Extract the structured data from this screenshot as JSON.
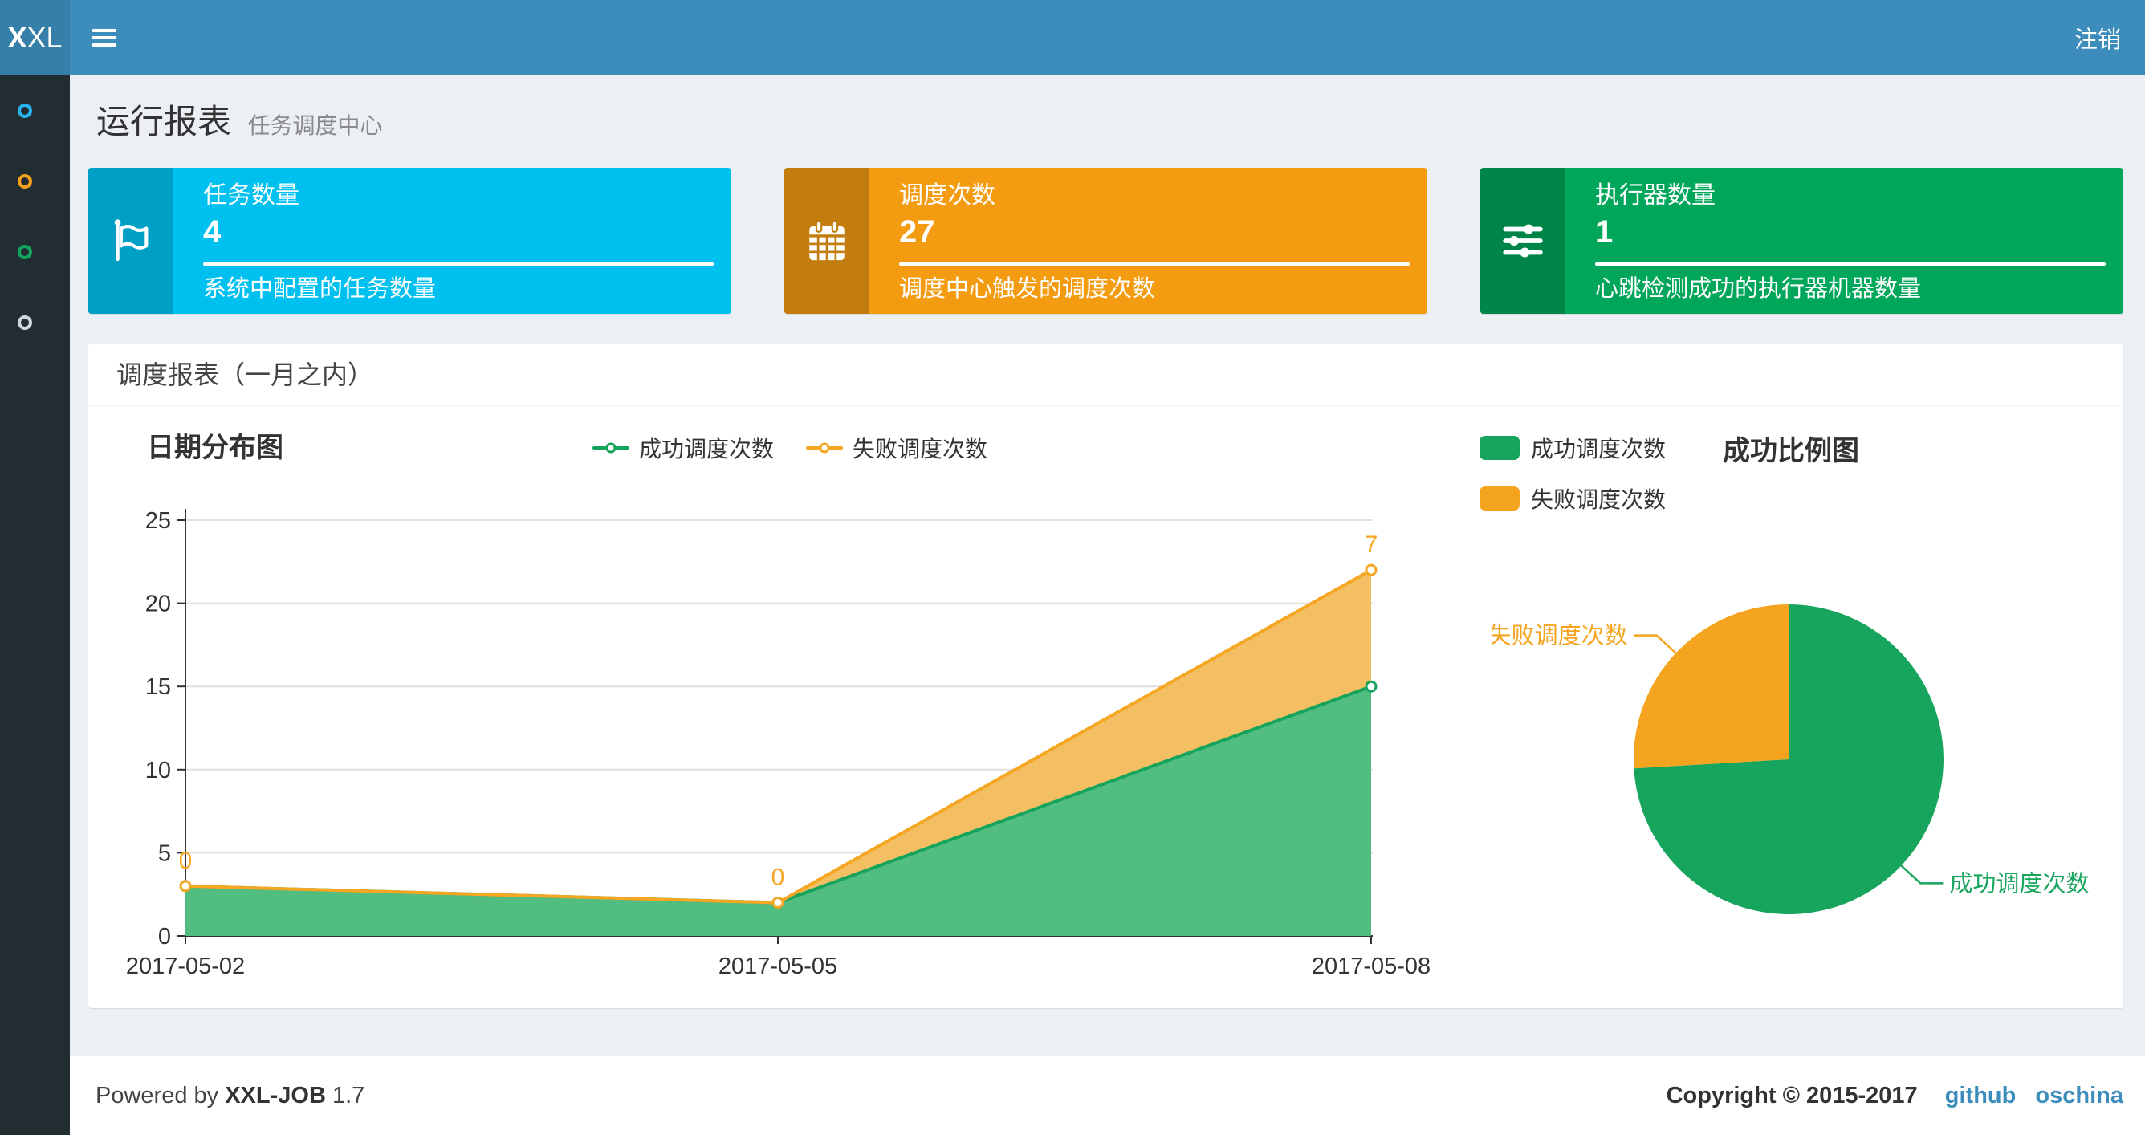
{
  "header": {
    "logo_prefix": "X",
    "logo_rest": "XL",
    "logout": "注销"
  },
  "sidebar": {
    "items": [
      {
        "name": "menu-1",
        "color": "#29b4f0"
      },
      {
        "name": "menu-2",
        "color": "#f3a01c"
      },
      {
        "name": "menu-3",
        "color": "#12a45e"
      },
      {
        "name": "menu-4",
        "color": "#d2d6de"
      }
    ]
  },
  "page": {
    "title": "运行报表",
    "subtitle": "任务调度中心"
  },
  "stats": [
    {
      "label": "任务数量",
      "value": "4",
      "desc": "系统中配置的任务数量",
      "color": "#00c0ef",
      "icon": "flag-icon"
    },
    {
      "label": "调度次数",
      "value": "27",
      "desc": "调度中心触发的调度次数",
      "color": "#f39c12",
      "icon": "calendar-icon"
    },
    {
      "label": "执行器数量",
      "value": "1",
      "desc": "心跳检测成功的执行器机器数量",
      "color": "#00a65a",
      "icon": "sliders-icon"
    }
  ],
  "panel": {
    "title": "调度报表（一月之内）"
  },
  "chart_data": [
    {
      "type": "area",
      "title": "日期分布图",
      "stacked": true,
      "x": [
        "2017-05-02",
        "2017-05-05",
        "2017-05-08"
      ],
      "series": [
        {
          "name": "成功调度次数",
          "values": [
            3,
            2,
            15
          ],
          "color": "#16a45c",
          "fill": "#52bd81"
        },
        {
          "name": "失败调度次数",
          "values": [
            0,
            0,
            7
          ],
          "color": "#f5a623",
          "fill": "#f4bf63",
          "data_labels": true
        }
      ],
      "ylim": [
        0,
        25
      ],
      "yticks": [
        0,
        5,
        10,
        15,
        20,
        25
      ],
      "grid": true,
      "legend_position": "top-center"
    },
    {
      "type": "pie",
      "title": "成功比例图",
      "slices": [
        {
          "name": "成功调度次数",
          "value": 20,
          "color": "#17a45c"
        },
        {
          "name": "失败调度次数",
          "value": 7,
          "color": "#f5a41f"
        }
      ],
      "legend_position": "top-left"
    }
  ],
  "footer": {
    "powered_prefix": "Powered by",
    "powered_brand": "XXL-JOB",
    "powered_version": "1.7",
    "copyright": "Copyright © 2015-2017",
    "links": [
      {
        "label": "github"
      },
      {
        "label": "oschina"
      }
    ]
  }
}
